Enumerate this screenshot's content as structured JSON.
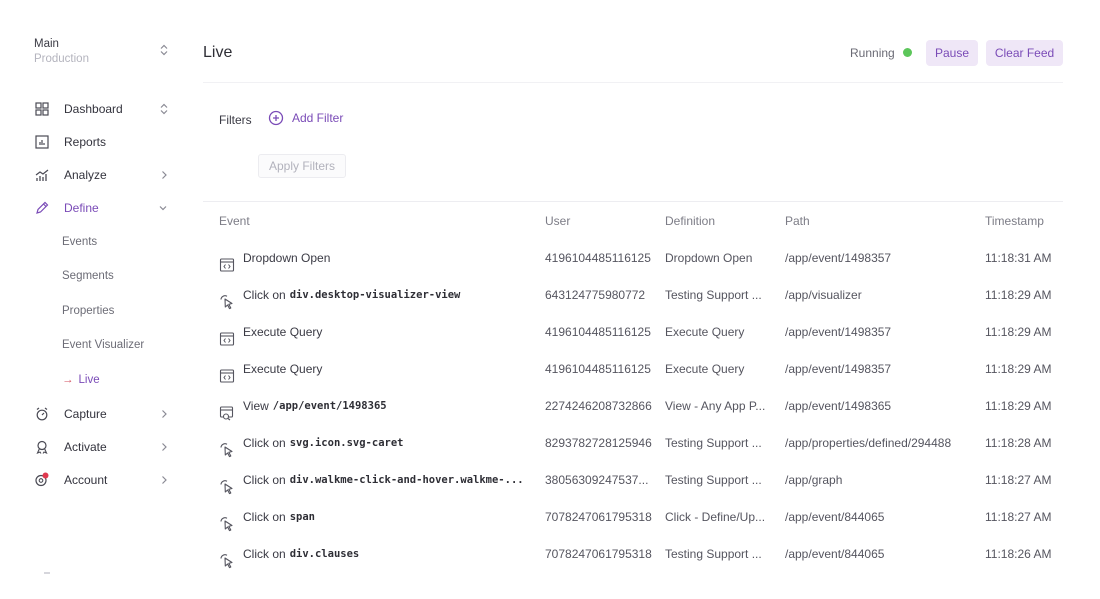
{
  "sidebar": {
    "env_name": "Main",
    "env_sub": "Production",
    "nav": [
      {
        "label": "Dashboard",
        "icon": "dashboard-icon"
      },
      {
        "label": "Reports",
        "icon": "reports-icon"
      },
      {
        "label": "Analyze",
        "icon": "analyze-icon"
      },
      {
        "label": "Define",
        "icon": "define-icon"
      },
      {
        "label": "Capture",
        "icon": "capture-icon"
      },
      {
        "label": "Activate",
        "icon": "activate-icon"
      },
      {
        "label": "Account",
        "icon": "account-icon"
      }
    ],
    "define_sub": [
      {
        "label": "Events"
      },
      {
        "label": "Segments"
      },
      {
        "label": "Properties"
      },
      {
        "label": "Event Visualizer"
      },
      {
        "label": "Live"
      }
    ],
    "live_arrow": "→"
  },
  "header": {
    "title": "Live",
    "status": "Running",
    "pause_label": "Pause",
    "clear_label": "Clear Feed",
    "status_color": "#5cc65a",
    "accent": "#7a4bb7"
  },
  "filters": {
    "label": "Filters",
    "add_label": "Add Filter",
    "apply_label": "Apply Filters"
  },
  "table": {
    "headers": {
      "event": "Event",
      "user": "User",
      "definition": "Definition",
      "path": "Path",
      "timestamp": "Timestamp"
    },
    "rows": [
      {
        "type": "window",
        "text": "Dropdown Open",
        "code": "",
        "user": "4196104485116125",
        "definition": "Dropdown Open",
        "path": "/app/event/1498357",
        "time": "11:18:31 AM"
      },
      {
        "type": "click",
        "text": "Click on",
        "code": "div.desktop-visualizer-view",
        "user": "643124775980772",
        "definition": "Testing Support ...",
        "path": "/app/visualizer",
        "time": "11:18:29 AM"
      },
      {
        "type": "window",
        "text": "Execute Query",
        "code": "",
        "user": "4196104485116125",
        "definition": "Execute Query",
        "path": "/app/event/1498357",
        "time": "11:18:29 AM"
      },
      {
        "type": "window",
        "text": "Execute Query",
        "code": "",
        "user": "4196104485116125",
        "definition": "Execute Query",
        "path": "/app/event/1498357",
        "time": "11:18:29 AM"
      },
      {
        "type": "view",
        "text": "View",
        "code": "/app/event/1498365",
        "user": "2274246208732866",
        "definition": "View - Any App P...",
        "path": "/app/event/1498365",
        "time": "11:18:29 AM"
      },
      {
        "type": "click",
        "text": "Click on",
        "code": "svg.icon.svg-caret",
        "user": "8293782728125946",
        "definition": "Testing Support ...",
        "path": "/app/properties/defined/294488",
        "time": "11:18:28 AM"
      },
      {
        "type": "click",
        "text": "Click on",
        "code": "div.walkme-click-and-hover.walkme-...",
        "user": "38056309247537...",
        "definition": "Testing Support ...",
        "path": "/app/graph",
        "time": "11:18:27 AM"
      },
      {
        "type": "click",
        "text": "Click on",
        "code": "span",
        "user": "7078247061795318",
        "definition": "Click - Define/Up...",
        "path": "/app/event/844065",
        "time": "11:18:27 AM"
      },
      {
        "type": "click",
        "text": "Click on",
        "code": "div.clauses",
        "user": "7078247061795318",
        "definition": "Testing Support ...",
        "path": "/app/event/844065",
        "time": "11:18:26 AM"
      }
    ]
  }
}
